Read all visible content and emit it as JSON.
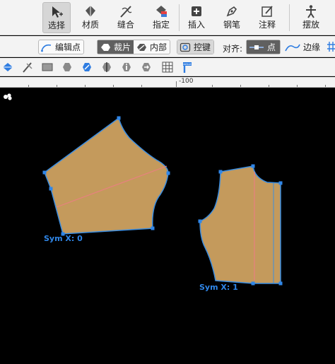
{
  "toolbar": {
    "tools": [
      {
        "id": "select",
        "label": "选择",
        "icon": "select-cursor-icon",
        "active": true
      },
      {
        "id": "material",
        "label": "材质",
        "icon": "material-diamond-icon",
        "active": false
      },
      {
        "id": "sewing",
        "label": "缝合",
        "icon": "sewing-needle-icon",
        "active": false
      },
      {
        "id": "assign",
        "label": "指定",
        "icon": "assign-palette-icon",
        "active": false
      },
      {
        "id": "insert",
        "label": "插入",
        "icon": "insert-plus-icon",
        "active": false
      },
      {
        "id": "pen",
        "label": "钢笔",
        "icon": "pen-nib-icon",
        "active": false
      },
      {
        "id": "annotate",
        "label": "注释",
        "icon": "annotate-note-icon",
        "active": false
      },
      {
        "id": "pose",
        "label": "摆放",
        "icon": "pose-figure-icon",
        "active": false
      }
    ]
  },
  "subtoolbar": {
    "edit_point": "编辑点",
    "piece_mode": {
      "cut": "裁片",
      "inner": "内部"
    },
    "control_key": "控键",
    "align_label": "对齐:",
    "align_point": "点",
    "align_edge": "边缘"
  },
  "icon_row": {
    "icons": [
      "piece-diamond-icon",
      "knife-icon",
      "rectangle-piece-icon",
      "rounded-piece-icon",
      "flip-piece-icon",
      "mirror-piece-icon",
      "info-piece-icon",
      "arrow-piece-icon",
      "grid-icon",
      "pin-marker-icon"
    ],
    "pin_badge": "default"
  },
  "ruler": {
    "label": "-100"
  },
  "canvas": {
    "pieces": [
      {
        "name": "left-pattern-piece",
        "sym_label": "Sym X: 0"
      },
      {
        "name": "right-pattern-piece",
        "sym_label": "Sym X: 1"
      }
    ],
    "colors": {
      "background": "#000000",
      "piece_fill": "#c49a5c",
      "outline": "#3b8de0",
      "grain_line": "#e98080"
    }
  }
}
